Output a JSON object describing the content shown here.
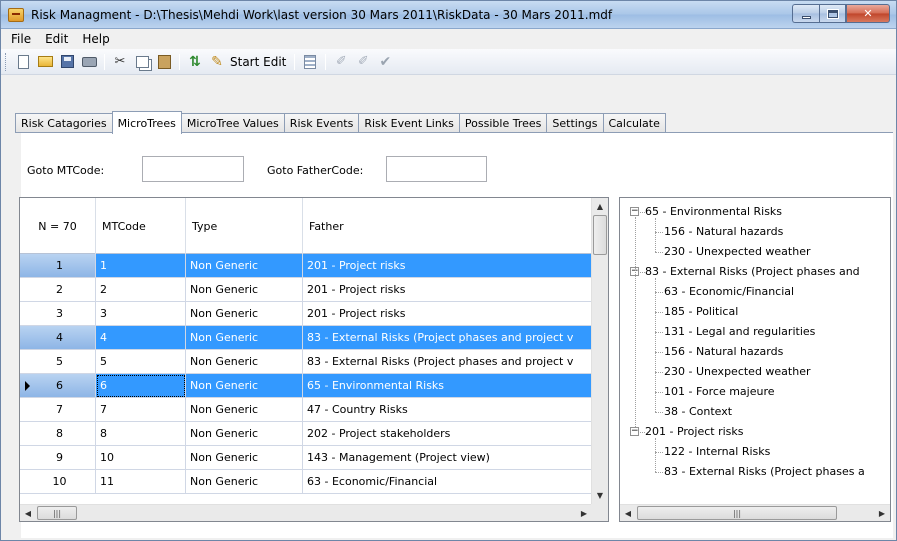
{
  "window": {
    "title": "Risk Managment - D:\\Thesis\\Mehdi Work\\last version 30 Mars 2011\\RiskData - 30 Mars 2011.mdf"
  },
  "menu": [
    "File",
    "Edit",
    "Help"
  ],
  "toolbar": {
    "icons": [
      "new-icon",
      "open-icon",
      "save-icon",
      "print-icon",
      "cut-icon",
      "copy-icon",
      "paste-icon",
      "refresh-icon",
      "pencil-icon",
      "grid-icon",
      "disabled-edit-icon",
      "disabled-edit-icon",
      "check-icon"
    ],
    "start_edit_label": "Start Edit"
  },
  "tabs": [
    {
      "label": "Risk Catagories",
      "active": false
    },
    {
      "label": "MicroTrees",
      "active": true
    },
    {
      "label": "MicroTree Values",
      "active": false
    },
    {
      "label": "Risk Events",
      "active": false
    },
    {
      "label": "Risk Event Links",
      "active": false
    },
    {
      "label": "Possible Trees",
      "active": false
    },
    {
      "label": "Settings",
      "active": false
    },
    {
      "label": "Calculate",
      "active": false
    }
  ],
  "goto": {
    "mtcode_label": "Goto MTCode:",
    "mtcode_value": "",
    "fathercode_label": "Goto FatherCode:",
    "fathercode_value": ""
  },
  "grid": {
    "header_count": "N = 70",
    "columns": [
      "MTCode",
      "Type",
      "Father"
    ],
    "rows": [
      {
        "n": "1",
        "mtcode": "1",
        "type": "Non Generic",
        "father": "201 - Project risks",
        "selected": true,
        "current": false
      },
      {
        "n": "2",
        "mtcode": "2",
        "type": "Non Generic",
        "father": "201 - Project risks",
        "selected": false,
        "current": false
      },
      {
        "n": "3",
        "mtcode": "3",
        "type": "Non Generic",
        "father": "201 - Project risks",
        "selected": false,
        "current": false
      },
      {
        "n": "4",
        "mtcode": "4",
        "type": "Non Generic",
        "father": "83 - External Risks (Project phases and  project v",
        "selected": true,
        "current": false
      },
      {
        "n": "5",
        "mtcode": "5",
        "type": "Non Generic",
        "father": "83 - External Risks (Project phases and  project v",
        "selected": false,
        "current": false
      },
      {
        "n": "6",
        "mtcode": "6",
        "type": "Non Generic",
        "father": "65 - Environmental Risks",
        "selected": true,
        "current": true
      },
      {
        "n": "7",
        "mtcode": "7",
        "type": "Non Generic",
        "father": "47 - Country Risks",
        "selected": false,
        "current": false
      },
      {
        "n": "8",
        "mtcode": "8",
        "type": "Non Generic",
        "father": "202 - Project stakeholders",
        "selected": false,
        "current": false
      },
      {
        "n": "9",
        "mtcode": "10",
        "type": "Non Generic",
        "father": "143 - Management (Project view)",
        "selected": false,
        "current": false
      },
      {
        "n": "10",
        "mtcode": "11",
        "type": "Non Generic",
        "father": "63 - Economic/Financial",
        "selected": false,
        "current": false
      }
    ]
  },
  "tree": [
    {
      "label": "65 - Environmental Risks",
      "level": 0,
      "expanded": true
    },
    {
      "label": "156 - Natural hazards",
      "level": 1
    },
    {
      "label": "230 - Unexpected weather",
      "level": 1
    },
    {
      "label": "83 - External Risks (Project phases and",
      "level": 0,
      "expanded": true
    },
    {
      "label": "63 - Economic/Financial",
      "level": 1
    },
    {
      "label": "185 - Political",
      "level": 1
    },
    {
      "label": "131 - Legal and regularities",
      "level": 1
    },
    {
      "label": "156 - Natural hazards",
      "level": 1
    },
    {
      "label": "230 - Unexpected weather",
      "level": 1
    },
    {
      "label": "101 - Force majeure",
      "level": 1
    },
    {
      "label": "38 - Context",
      "level": 1
    },
    {
      "label": "201 - Project risks",
      "level": 0,
      "expanded": true
    },
    {
      "label": "122 - Internal Risks",
      "level": 1
    },
    {
      "label": "83 - External Risks (Project phases a",
      "level": 1
    }
  ],
  "colors": {
    "selection": "#3399ff",
    "title_bar": "#a9c6e8",
    "close_button": "#c0452a"
  }
}
